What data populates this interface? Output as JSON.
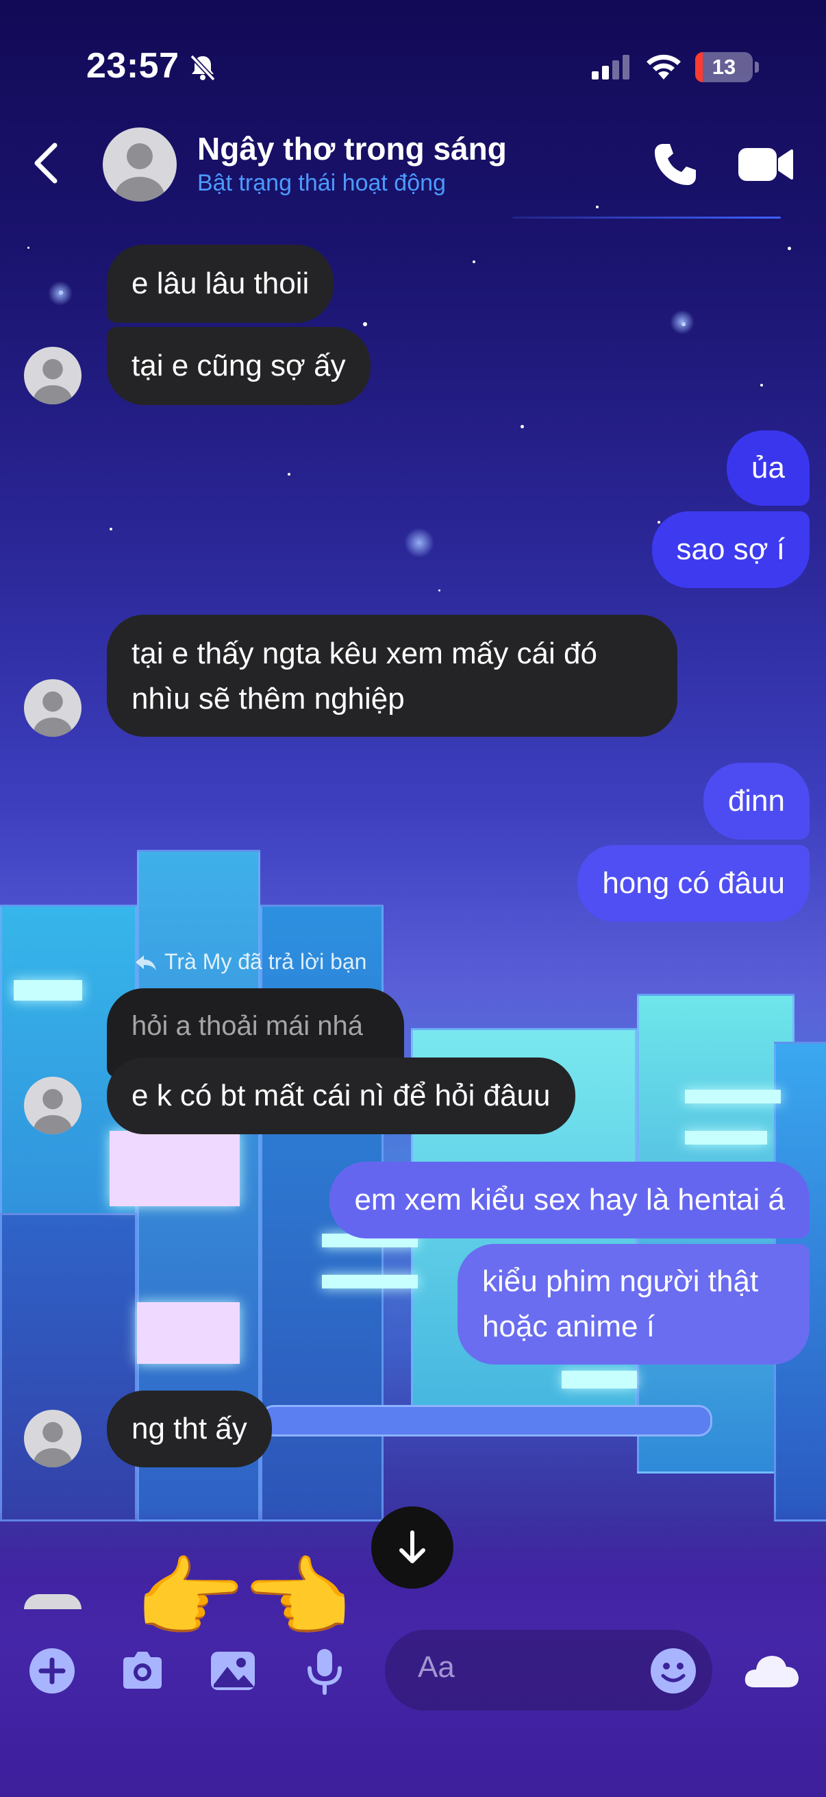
{
  "status_bar": {
    "time": "23:57",
    "battery": "13",
    "battery_level_percent": 13,
    "icons": [
      "bell-slash-icon",
      "cellular-signal-icon",
      "wifi-icon",
      "battery-icon"
    ]
  },
  "header": {
    "contact_name": "Ngây thơ trong sáng",
    "subtitle": "Bật trạng thái hoạt động",
    "icons": [
      "back-chevron-icon",
      "avatar",
      "phone-icon",
      "video-camera-icon"
    ]
  },
  "messages": [
    {
      "side": "in",
      "text": "e lâu lâu thoii"
    },
    {
      "side": "in",
      "text": "tại e cũng sợ ấy"
    },
    {
      "side": "out",
      "text": "ủa"
    },
    {
      "side": "out",
      "text": "sao sợ í"
    },
    {
      "side": "in",
      "lines": [
        "tại e thấy ngta kêu xem mấy cái đó",
        "nhìu sẽ thêm nghiệp"
      ]
    },
    {
      "side": "out",
      "text": "đinn"
    },
    {
      "side": "out",
      "text": "hong có đâuu"
    },
    {
      "side": "in",
      "reply_note": "Trà My đã trả lời bạn",
      "quoted": "hỏi a thoải mái nhá",
      "text": "e k có bt mất cái nì để hỏi đâuu"
    },
    {
      "side": "out",
      "text": "em xem kiểu sex hay là hentai á"
    },
    {
      "side": "out",
      "lines": [
        "kiểu phim người thật",
        "hoặc anime í"
      ]
    },
    {
      "side": "in",
      "text": "ng tht ấy"
    },
    {
      "side": "in",
      "emoji": "👉👈"
    }
  ],
  "composer": {
    "placeholder": "Aa",
    "icons": [
      "plus-icon",
      "camera-icon",
      "image-icon",
      "microphone-icon",
      "smiley-icon",
      "cloud-icon"
    ]
  },
  "colors": {
    "incoming_bubble": "#242426",
    "outgoing_blue_top": "#3b3bf0",
    "outgoing_purple_bottom": "#6a6df0",
    "subtitle_blue": "#4c9bff",
    "composer_icon": "#a9b4ff"
  }
}
